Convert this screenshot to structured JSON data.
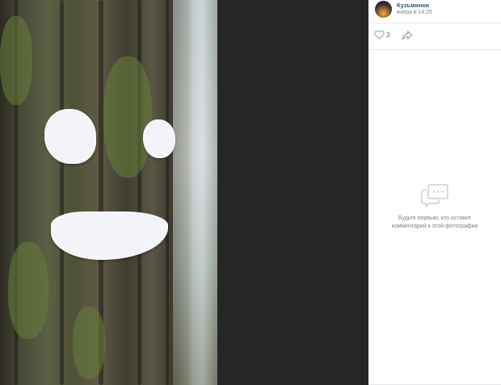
{
  "post": {
    "author": "Кузьминки",
    "time": "вчера в 14:25"
  },
  "actions": {
    "likes": "3"
  },
  "comments": {
    "empty_text": "Будьте первым, кто оставит комментарий к этой фотографии"
  },
  "icons": {
    "like": "heart-icon",
    "share": "share-arrow-icon",
    "comments": "comments-bubbles-icon"
  },
  "colors": {
    "viewer_bg": "#262626",
    "author_link": "#2a5885",
    "muted_text": "#828282"
  }
}
